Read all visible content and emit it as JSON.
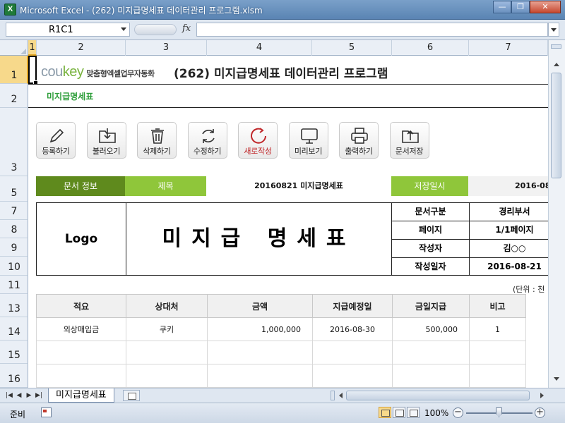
{
  "window": {
    "title": "Microsoft Excel - (262) 미지급명세표 데이터관리 프로그램.xlsm",
    "app_icon": "X",
    "buttons": {
      "minimize": "—",
      "maximize": "❐",
      "close": "✕"
    }
  },
  "formula_bar": {
    "name_box": "R1C1",
    "fx_label": "fx",
    "formula": ""
  },
  "columns": [
    "1",
    "2",
    "3",
    "4",
    "5",
    "6",
    "7"
  ],
  "rows": [
    "1",
    "2",
    "3",
    "5",
    "7",
    "8",
    "9",
    "10",
    "11",
    "13",
    "14",
    "15",
    "16"
  ],
  "sheet": {
    "brand_logo": "coukey",
    "brand_tagline": "맞춤형엑셀업무자동화",
    "app_title": "(262) 미지급명세표 데이터관리 프로그램",
    "subtitle": "미지급명세표",
    "toolbar": [
      {
        "label": "등록하기",
        "icon": "pencil-icon"
      },
      {
        "label": "불러오기",
        "icon": "folder-download-icon"
      },
      {
        "label": "삭제하기",
        "icon": "trash-icon"
      },
      {
        "label": "수정하기",
        "icon": "refresh-icon"
      },
      {
        "label": "새로작성",
        "icon": "new-circle-icon"
      },
      {
        "label": "미리보기",
        "icon": "monitor-icon"
      },
      {
        "label": "출력하기",
        "icon": "printer-icon"
      },
      {
        "label": "문서저장",
        "icon": "folder-upload-icon"
      }
    ],
    "info": {
      "doc_info_label": "문서 정보",
      "title_label": "제목",
      "title_value": "20160821 미지급명세표",
      "saved_label": "저장일시",
      "saved_value": "2016-08"
    },
    "document": {
      "logo": "Logo",
      "title": "미지급 명세표",
      "meta": [
        {
          "key": "문서구분",
          "value": "경리부서"
        },
        {
          "key": "페이지",
          "value": "1/1페이지"
        },
        {
          "key": "작성자",
          "value": "김○○"
        },
        {
          "key": "작성일자",
          "value": "2016-08-21"
        }
      ]
    },
    "unit_note": "(단위 : 천",
    "table": {
      "headers": [
        "적요",
        "상대처",
        "금액",
        "지급예정일",
        "금일지급",
        "비고"
      ],
      "rows": [
        [
          "외상매입금",
          "쿠키",
          "1,000,000",
          "2016-08-30",
          "500,000",
          "1"
        ]
      ]
    }
  },
  "tabs": {
    "sheet_name": "미지급명세표"
  },
  "status": {
    "ready": "준비",
    "zoom": "100%"
  }
}
